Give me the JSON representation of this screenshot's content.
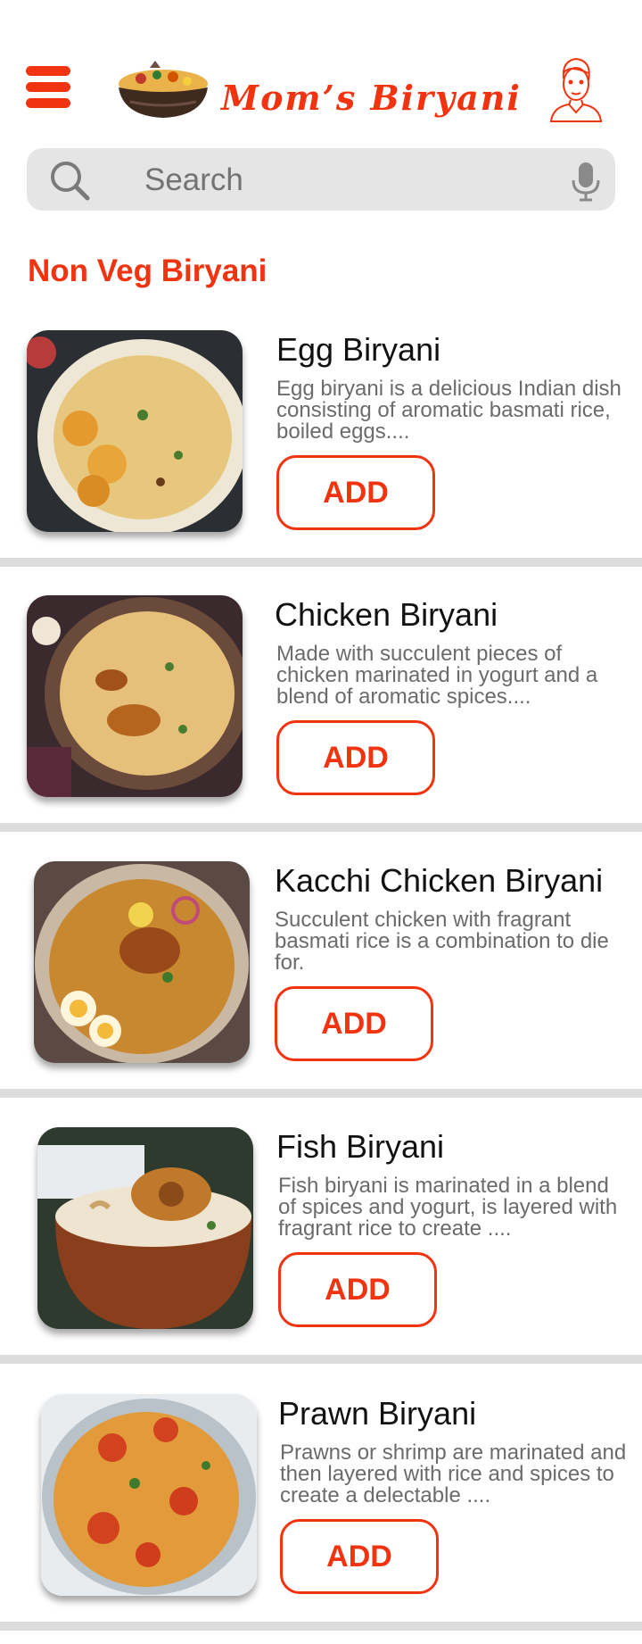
{
  "header": {
    "brand_name": "Mom’s Biryani",
    "brand_color": "#f2330f"
  },
  "search": {
    "placeholder": "Search"
  },
  "section": {
    "title": "Non Veg Biryani"
  },
  "dishes": [
    {
      "name": "Egg Biryani",
      "description": "Egg biryani is a delicious Indian dish consisting of aromatic basmati rice, boiled eggs....",
      "button": "ADD"
    },
    {
      "name": "Chicken Biryani",
      "description": "Made with succulent pieces of chicken marinated in yogurt and a blend of aromatic spices....",
      "button": "ADD"
    },
    {
      "name": "Kacchi Chicken Biryani",
      "description": "Succulent chicken with fragrant basmati rice is a combination to die for.",
      "button": "ADD"
    },
    {
      "name": "Fish Biryani",
      "description": "Fish biryani is marinated in a blend of spices and yogurt, is layered with fragrant rice to create ....",
      "button": "ADD"
    },
    {
      "name": "Prawn Biryani",
      "description": "Prawns or shrimp are marinated and then layered with rice and spices to create a delectable ....",
      "button": "ADD"
    }
  ],
  "icons": {
    "menu": "hamburger-menu-icon",
    "logo": "biryani-bowl-logo",
    "profile": "user-avatar-icon",
    "search": "search-icon",
    "voice": "microphone-icon"
  }
}
